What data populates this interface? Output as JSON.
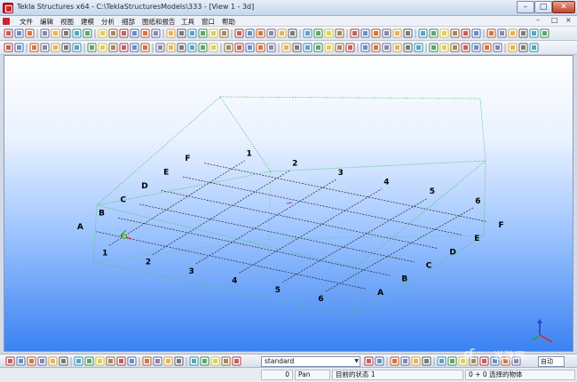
{
  "window": {
    "title": "Tekla Structures x64 - C:\\TeklaStructuresModels\\333 - [View 1 - 3d]",
    "minimize_glyph": "–",
    "maximize_glyph": "□",
    "close_glyph": "✕"
  },
  "menu": {
    "items": [
      "文件",
      "编辑",
      "视图",
      "建模",
      "分析",
      "细部",
      "图纸和报告",
      "工具",
      "窗口",
      "帮助"
    ],
    "right_controls": [
      "–",
      "□",
      "×"
    ]
  },
  "viewport": {
    "grid_x_labels": [
      "1",
      "2",
      "3",
      "4",
      "5",
      "6"
    ],
    "grid_y_labels": [
      "A",
      "B",
      "C",
      "D",
      "E",
      "F"
    ],
    "colors": {
      "grid_line": "#222222",
      "bounding_box": "#56c27a",
      "axis_x": "#d62828",
      "axis_y": "#27a33a",
      "axis_z": "#2b3fd6"
    }
  },
  "command_bar": {
    "view_select": "standard",
    "zoom_select": "自动"
  },
  "status_bar": {
    "coord_value": "0",
    "mode": "Pan",
    "current_state_label": "目前的状态 1",
    "selection": "0 + 0 选择的物体"
  },
  "watermark": {
    "text": "当游网"
  }
}
